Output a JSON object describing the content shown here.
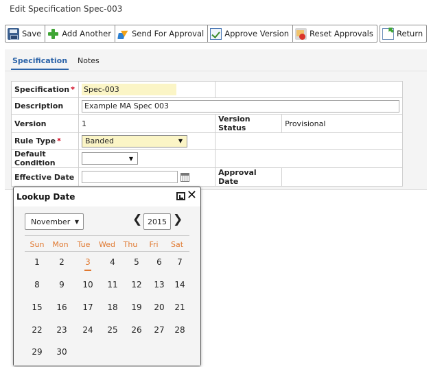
{
  "page": {
    "title": "Edit Specification Spec-003"
  },
  "toolbar": {
    "save_label": "Save",
    "add_another_label": "Add Another",
    "send_for_approval_label": "Send For Approval",
    "approve_version_label": "Approve Version",
    "reset_approvals_label": "Reset Approvals",
    "return_label": "Return"
  },
  "tabs": [
    {
      "label": "Specification",
      "active": true
    },
    {
      "label": "Notes",
      "active": false
    }
  ],
  "form": {
    "specification": {
      "label": "Specification",
      "value": "Spec-003",
      "required": "*"
    },
    "description": {
      "label": "Description",
      "value": "Example MA Spec 003"
    },
    "version": {
      "label": "Version",
      "value": "1"
    },
    "version_status": {
      "label": "Version Status",
      "value": "Provisional"
    },
    "rule_type": {
      "label": "Rule Type",
      "value": "Banded",
      "required": "*"
    },
    "default_condition": {
      "label": "Default Condition",
      "value": ""
    },
    "effective_date": {
      "label": "Effective Date",
      "value": ""
    },
    "approval_date": {
      "label": "Approval Date",
      "value": ""
    }
  },
  "calendar": {
    "title": "Lookup Date",
    "month": "November",
    "year": "2015",
    "prev_glyph": "❮",
    "next_glyph": "❯",
    "close_glyph": "✕",
    "dow": [
      "Sun",
      "Mon",
      "Tue",
      "Wed",
      "Thu",
      "Fri",
      "Sat"
    ],
    "weeks": [
      [
        "1",
        "2",
        "3",
        "4",
        "5",
        "6",
        "7"
      ],
      [
        "8",
        "9",
        "10",
        "11",
        "12",
        "13",
        "14"
      ],
      [
        "15",
        "16",
        "17",
        "18",
        "19",
        "20",
        "21"
      ],
      [
        "22",
        "23",
        "24",
        "25",
        "26",
        "27",
        "28"
      ],
      [
        "29",
        "30"
      ]
    ],
    "highlighted_day": "3",
    "accent_color": "#e0782f"
  },
  "icons": {
    "save": "floppy-disk-icon",
    "add": "green-plus-icon",
    "send": "send-approval-icon",
    "approve": "approve-check-icon",
    "reset": "reset-approvals-icon",
    "return": "return-arrow-icon",
    "calendar": "calendar-icon"
  }
}
